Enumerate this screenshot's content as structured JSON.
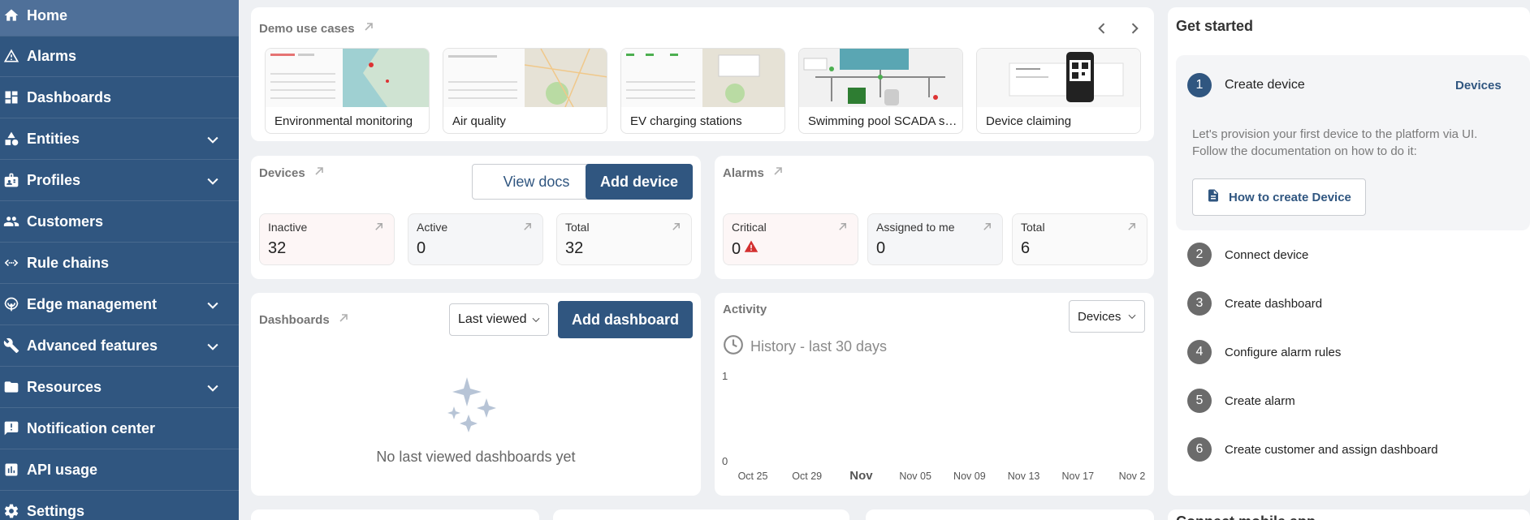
{
  "sidebar": {
    "items": [
      {
        "label": "Home",
        "icon": "home-icon"
      },
      {
        "label": "Alarms",
        "icon": "alarm-icon"
      },
      {
        "label": "Dashboards",
        "icon": "dashboards-icon"
      },
      {
        "label": "Entities",
        "icon": "entities-icon"
      },
      {
        "label": "Profiles",
        "icon": "profiles-icon"
      },
      {
        "label": "Customers",
        "icon": "customers-icon"
      },
      {
        "label": "Rule chains",
        "icon": "rule-chains-icon"
      },
      {
        "label": "Edge management",
        "icon": "edge-icon"
      },
      {
        "label": "Advanced features",
        "icon": "tools-icon"
      },
      {
        "label": "Resources",
        "icon": "folder-icon"
      },
      {
        "label": "Notification center",
        "icon": "notification-icon"
      },
      {
        "label": "API usage",
        "icon": "chart-icon"
      },
      {
        "label": "Settings",
        "icon": "gear-icon"
      }
    ]
  },
  "demo": {
    "title": "Demo use cases",
    "items": [
      {
        "label": "Environmental monitoring"
      },
      {
        "label": "Air quality"
      },
      {
        "label": "EV charging stations"
      },
      {
        "label": "Swimming pool SCADA system"
      },
      {
        "label": "Device claiming"
      }
    ]
  },
  "devices": {
    "title": "Devices",
    "view_docs": "View docs",
    "add_device": "Add device",
    "stats": [
      {
        "label": "Inactive",
        "value": "32"
      },
      {
        "label": "Active",
        "value": "0"
      },
      {
        "label": "Total",
        "value": "32"
      }
    ]
  },
  "alarms": {
    "title": "Alarms",
    "stats": [
      {
        "label": "Critical",
        "value": "0"
      },
      {
        "label": "Assigned to me",
        "value": "0"
      },
      {
        "label": "Total",
        "value": "6"
      }
    ]
  },
  "dashboards": {
    "title": "Dashboards",
    "select_value": "Last viewed",
    "add_dashboard": "Add dashboard",
    "empty_text": "No last viewed dashboards yet"
  },
  "activity": {
    "title": "Activity",
    "select_value": "Devices",
    "history_label": "History - last 30 days"
  },
  "chart_data": {
    "type": "line",
    "x": [
      "Oct 25",
      "Oct 29",
      "Nov",
      "Nov 05",
      "Nov 09",
      "Nov 13",
      "Nov 17",
      "Nov 2"
    ],
    "yticks": [
      "1",
      "0"
    ],
    "ylim": [
      0,
      1
    ],
    "series": []
  },
  "get_started": {
    "title": "Get started",
    "active_step": {
      "number": "1",
      "label": "Create device",
      "link": "Devices",
      "description_line1": "Let's provision your first device to the platform via UI.",
      "description_line2": "Follow the documentation on how to do it:",
      "doc_button": "How to create Device"
    },
    "steps": [
      {
        "number": "2",
        "label": "Connect device"
      },
      {
        "number": "3",
        "label": "Create dashboard"
      },
      {
        "number": "4",
        "label": "Configure alarm rules"
      },
      {
        "number": "5",
        "label": "Create alarm"
      },
      {
        "number": "6",
        "label": "Create customer and assign dashboard"
      }
    ]
  },
  "partial": {
    "mobile_title": "Connect mobile app"
  },
  "colors": {
    "sidebar_bg": "#305680",
    "sidebar_active": "#4f7099",
    "primary": "#305680",
    "critical": "#d32f2f"
  }
}
